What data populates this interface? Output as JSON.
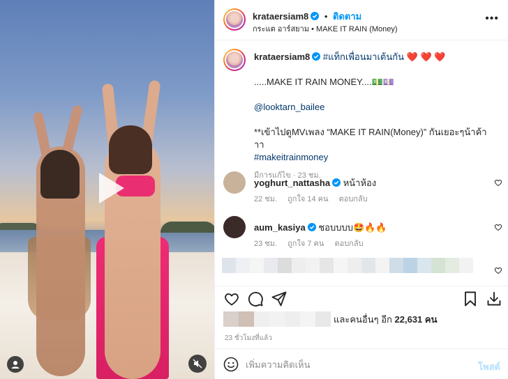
{
  "media": {
    "play_icon": "play-icon",
    "user_tag_icon": "user-icon",
    "mute_icon": "speaker-muted-icon"
  },
  "header": {
    "username": "krataersiam8",
    "verified": true,
    "separator": "•",
    "follow_label": "ติดตาม",
    "audio_artist": "กระแต อาร์สยาม",
    "audio_separator": "•",
    "audio_title": "MAKE IT RAIN (Money)",
    "more_icon": "more-horizontal-icon",
    "more_label": "•••"
  },
  "caption": {
    "username": "krataersiam8",
    "hashtag_first": "#แท็กเพื่อนมาเต้นกัน",
    "hearts": "❤️ ❤️ ❤️",
    "line2": ".....MAKE IT RAIN MONEY....💵💷",
    "mention": "@looktarn_bailee",
    "line4": "**เข้าไปดูMVเพลง “MAKE IT RAIN(Money)” กันเยอะๆน้าค้าาา",
    "hashtag_second": "#makeitrainmoney",
    "edited": "มีการแก้ไข",
    "time": "23 ชม.",
    "meta_sep": "·"
  },
  "comments": [
    {
      "username": "yoghurt_nattasha",
      "verified": true,
      "text": "หน้าห้อง",
      "time": "22 ชม.",
      "likes": "ถูกใจ 14 คน",
      "reply": "ตอบกลับ",
      "avatar_color": "#c9b29a"
    },
    {
      "username": "aum_kasiya",
      "verified": true,
      "text": "ชอบบบบ🤩🔥🔥",
      "time": "23 ชม.",
      "likes": "ถูกใจ 7 คน",
      "reply": "ตอบกลับ",
      "avatar_color": "#3a2a28"
    }
  ],
  "actions": {
    "like_icon": "heart-icon",
    "comment_icon": "comment-icon",
    "share_icon": "send-icon",
    "save_icon": "bookmark-icon",
    "download_icon": "download-icon"
  },
  "likes": {
    "prefix": "และคนอื่นๆ อีก",
    "count": "22,631",
    "suffix": "คน"
  },
  "time_ago": "23 ชั่วโมงที่แล้ว",
  "composer": {
    "emoji_icon": "smiley-icon",
    "placeholder": "เพิ่มความคิดเห็น",
    "post_label": "โพสต์"
  },
  "colors": {
    "link_blue": "#0095f6",
    "hashtag": "#00376b",
    "muted": "#8e8e8e",
    "post_disabled": "#b2dffc",
    "verified": "#0095f6"
  }
}
